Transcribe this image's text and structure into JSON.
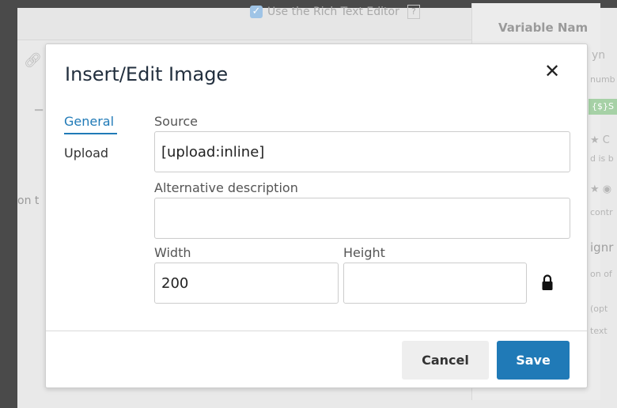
{
  "background": {
    "rich_text_label": "Use the Rich Text Editor",
    "help_label": "?",
    "variable_name_label": "Variable Nam",
    "faint_texts": [
      "yn",
      "numb",
      "{$}S",
      "★ C",
      "d is b",
      "★ ◉",
      "contr",
      "ignr",
      "on of",
      "(opt",
      "text",
      "on t"
    ]
  },
  "dialog": {
    "title": "Insert/Edit Image",
    "close_glyph": "✕",
    "tabs": [
      {
        "label": "General",
        "active": true
      },
      {
        "label": "Upload",
        "active": false
      }
    ],
    "fields": {
      "source": {
        "label": "Source",
        "value": "[upload:inline]"
      },
      "alt": {
        "label": "Alternative description",
        "value": ""
      },
      "width": {
        "label": "Width",
        "value": "200"
      },
      "height": {
        "label": "Height",
        "value": ""
      }
    },
    "buttons": {
      "cancel": "Cancel",
      "save": "Save"
    }
  },
  "colors": {
    "accent": "#207ab7",
    "overlay_bg": "#4a4a4a",
    "title_color": "#222f3e"
  },
  "icons": {
    "close": "close-icon",
    "lock": "lock-icon"
  }
}
